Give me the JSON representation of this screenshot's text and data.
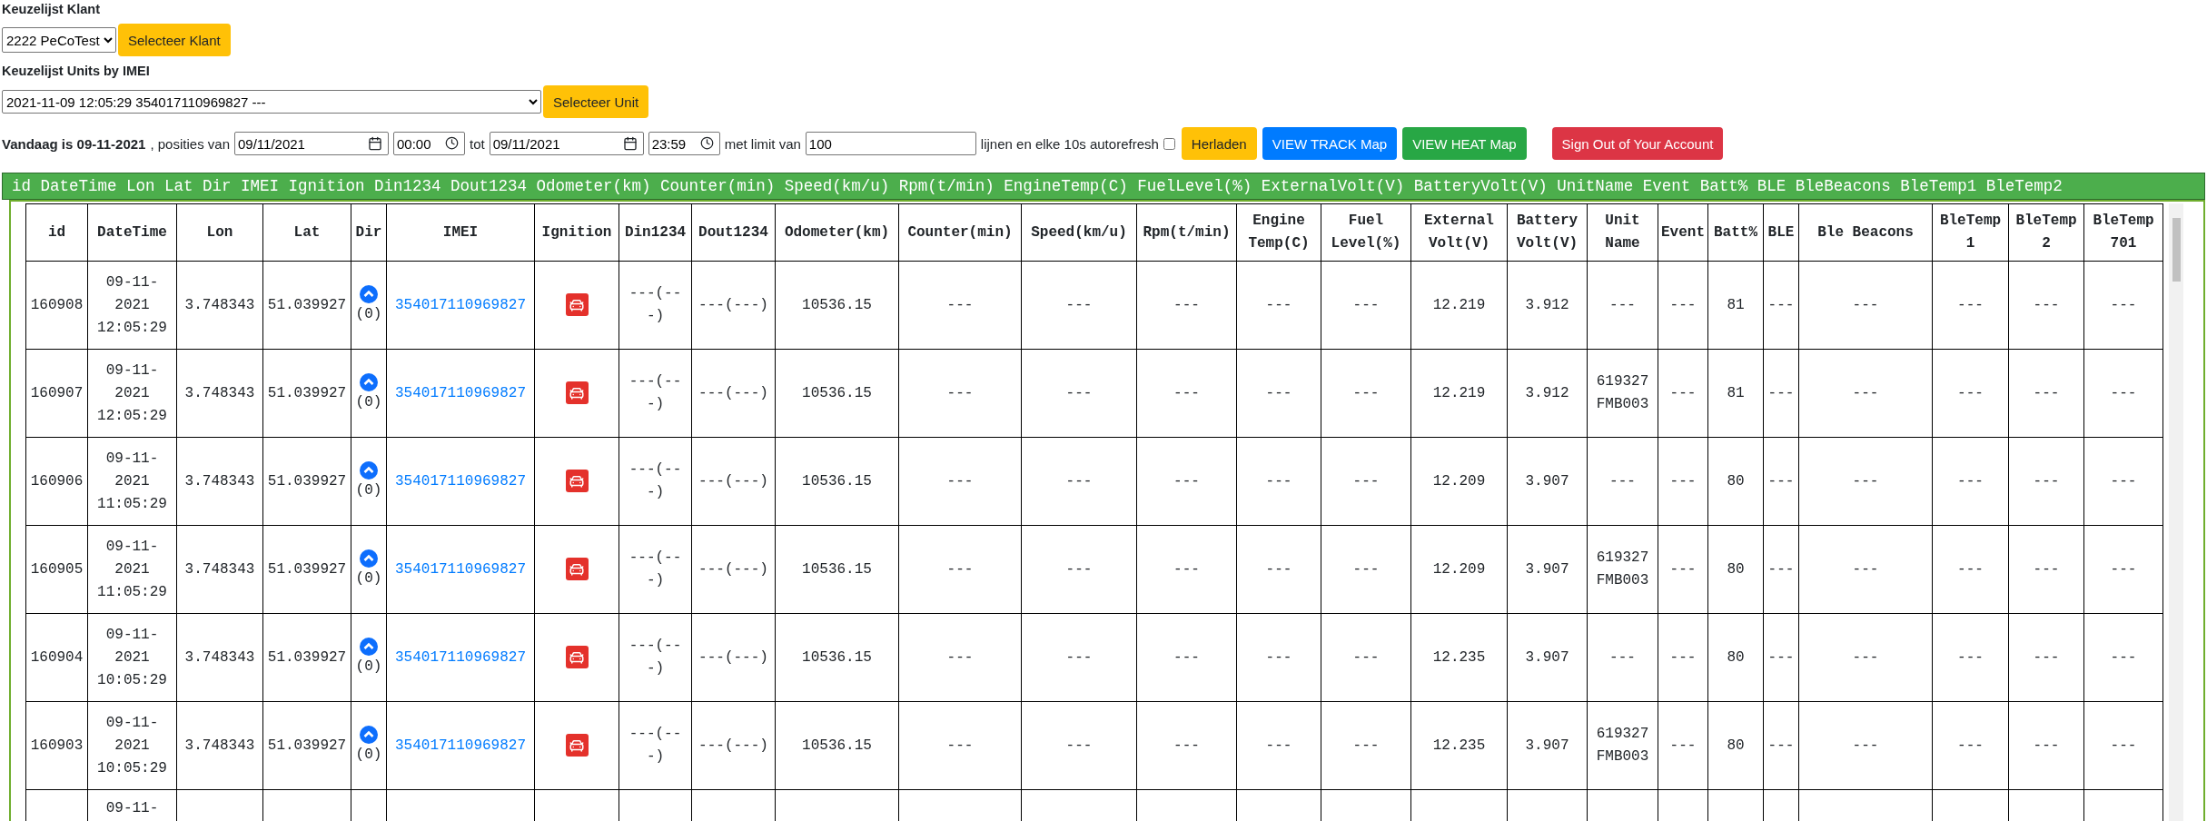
{
  "klant": {
    "label": "Keuzelijst Klant",
    "value": "2222 PeCoTest",
    "button": "Selecteer Klant"
  },
  "unit": {
    "label": "Keuzelijst Units by IMEI",
    "value": "2021-11-09 12:05:29 354017110969827 ---",
    "button": "Selecteer Unit"
  },
  "filter": {
    "today": "Vandaag is 09-11-2021",
    "from_text": ", posities van",
    "from_date": "09/11/2021",
    "from_time": "00:00",
    "to_text": "tot",
    "to_date": "09/11/2021",
    "to_time": "23:59",
    "limit_text": "met limit van",
    "limit": "100",
    "refresh_text": "lijnen en elke 10s autorefresh",
    "autorefresh": false
  },
  "actions": [
    {
      "label": "Herladen",
      "kind": "warning"
    },
    {
      "label": "VIEW TRACK Map",
      "kind": "primary"
    },
    {
      "label": "VIEW HEAT Map",
      "kind": "success"
    },
    {
      "label": "Sign Out of Your Account",
      "kind": "danger"
    }
  ],
  "banner": "id DateTime Lon Lat Dir IMEI Ignition Din1234 Dout1234 Odometer(km) Counter(min) Speed(km/u) Rpm(t/min) EngineTemp(C) FuelLevel(%) ExternalVolt(V) BatteryVolt(V) UnitName Event Batt% BLE BleBeacons BleTemp1 BleTemp2",
  "table": {
    "columns": [
      {
        "label": "id",
        "kind": "text"
      },
      {
        "label": "DateTime",
        "kind": "text"
      },
      {
        "label": "Lon",
        "kind": "text"
      },
      {
        "label": "Lat",
        "kind": "text"
      },
      {
        "label": "Dir",
        "kind": "dir"
      },
      {
        "label": "IMEI",
        "kind": "link"
      },
      {
        "label": "Ignition",
        "kind": "ignition"
      },
      {
        "label": "Din1234",
        "kind": "text"
      },
      {
        "label": "Dout1234",
        "kind": "text"
      },
      {
        "label": "Odometer(km)",
        "kind": "text"
      },
      {
        "label": "Counter(min)",
        "kind": "text"
      },
      {
        "label": "Speed(km/u)",
        "kind": "text"
      },
      {
        "label": "Rpm(t/min)",
        "kind": "text"
      },
      {
        "label": "Engine Temp(C)",
        "kind": "text"
      },
      {
        "label": "Fuel Level(%)",
        "kind": "text"
      },
      {
        "label": "External Volt(V)",
        "kind": "text"
      },
      {
        "label": "Battery Volt(V)",
        "kind": "text"
      },
      {
        "label": "Unit Name",
        "kind": "text"
      },
      {
        "label": "Event",
        "kind": "text"
      },
      {
        "label": "Batt%",
        "kind": "text"
      },
      {
        "label": "BLE",
        "kind": "text"
      },
      {
        "label": "Ble Beacons",
        "kind": "text"
      },
      {
        "label": "BleTemp 1",
        "kind": "text"
      },
      {
        "label": "BleTemp 2",
        "kind": "text"
      },
      {
        "label": "BleTemp 701",
        "kind": "text"
      }
    ],
    "rows": [
      {
        "cells": [
          "160908",
          "09-11-2021 12:05:29",
          "3.748343",
          "51.039927",
          "(0)",
          "354017110969827",
          "",
          "---(---)",
          "---(---)",
          "10536.15",
          "---",
          "---",
          "---",
          "---",
          "---",
          "12.219",
          "3.912",
          "---",
          "---",
          "81",
          "---",
          "---",
          "---",
          "---",
          "---"
        ]
      },
      {
        "cells": [
          "160907",
          "09-11-2021 12:05:29",
          "3.748343",
          "51.039927",
          "(0)",
          "354017110969827",
          "",
          "---(---)",
          "---(---)",
          "10536.15",
          "---",
          "---",
          "---",
          "---",
          "---",
          "12.219",
          "3.912",
          "619327 FMB003",
          "---",
          "81",
          "---",
          "---",
          "---",
          "---",
          "---"
        ]
      },
      {
        "cells": [
          "160906",
          "09-11-2021 11:05:29",
          "3.748343",
          "51.039927",
          "(0)",
          "354017110969827",
          "",
          "---(---)",
          "---(---)",
          "10536.15",
          "---",
          "---",
          "---",
          "---",
          "---",
          "12.209",
          "3.907",
          "---",
          "---",
          "80",
          "---",
          "---",
          "---",
          "---",
          "---"
        ]
      },
      {
        "cells": [
          "160905",
          "09-11-2021 11:05:29",
          "3.748343",
          "51.039927",
          "(0)",
          "354017110969827",
          "",
          "---(---)",
          "---(---)",
          "10536.15",
          "---",
          "---",
          "---",
          "---",
          "---",
          "12.209",
          "3.907",
          "619327 FMB003",
          "---",
          "80",
          "---",
          "---",
          "---",
          "---",
          "---"
        ]
      },
      {
        "cells": [
          "160904",
          "09-11-2021 10:05:29",
          "3.748343",
          "51.039927",
          "(0)",
          "354017110969827",
          "",
          "---(---)",
          "---(---)",
          "10536.15",
          "---",
          "---",
          "---",
          "---",
          "---",
          "12.235",
          "3.907",
          "---",
          "---",
          "80",
          "---",
          "---",
          "---",
          "---",
          "---"
        ]
      },
      {
        "cells": [
          "160903",
          "09-11-2021 10:05:29",
          "3.748343",
          "51.039927",
          "(0)",
          "354017110969827",
          "",
          "---(---)",
          "---(---)",
          "10536.15",
          "---",
          "---",
          "---",
          "---",
          "---",
          "12.235",
          "3.907",
          "619327 FMB003",
          "---",
          "80",
          "---",
          "---",
          "---",
          "---",
          "---"
        ]
      }
    ],
    "cut_row_datetime": "09-11-"
  }
}
